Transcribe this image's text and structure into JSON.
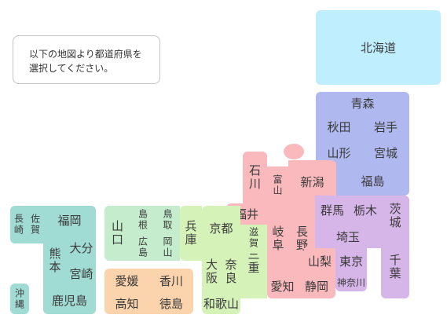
{
  "instruction": "以下の地図より都道府県を\n選択してください。",
  "prefectures": {
    "hokkaido": "北海道",
    "aomori": "青森",
    "akita": "秋田",
    "iwate": "岩手",
    "yamagata": "山形",
    "miyagi": "宮城",
    "fukushima": "福島",
    "niigata": "新潟",
    "toyama": "富山",
    "ishikawa": "石川",
    "fukui": "福井",
    "gifu": "岐阜",
    "nagano": "長野",
    "gunma": "群馬",
    "tochigi": "栃木",
    "ibaraki": "茨城",
    "saitama": "埼玉",
    "chiba": "千葉",
    "tokyo": "東京",
    "kanagawa": "神奈川",
    "yamanashi": "山梨",
    "shizuoka": "静岡",
    "aichi": "愛知",
    "mie": "三重",
    "shiga": "滋賀",
    "kyoto": "京都",
    "osaka": "大阪",
    "nara": "奈良",
    "wakayama": "和歌山",
    "hyogo": "兵庫",
    "tottori": "鳥取",
    "shimane": "島根",
    "okayama": "岡山",
    "hiroshima": "広島",
    "yamaguchi": "山口",
    "kagawa": "香川",
    "ehime": "愛媛",
    "tokushima": "徳島",
    "kochi": "高知",
    "fukuoka": "福岡",
    "saga": "佐賀",
    "nagasaki": "長崎",
    "kumamoto": "熊本",
    "oita": "大分",
    "miyazaki": "宮崎",
    "kagoshima": "鹿児島",
    "okinawa": "沖縄"
  },
  "colors": {
    "hokkaido": "#bfeeff",
    "tohoku": "#b0b8f0",
    "kanto": "#d6b5e8",
    "chubu": "#f9b9bd",
    "kinki": "#d5f3b9",
    "chugoku": "#c5eccc",
    "shikoku": "#fbd4ad",
    "kyushu_okinawa": "#a1dcd4"
  }
}
